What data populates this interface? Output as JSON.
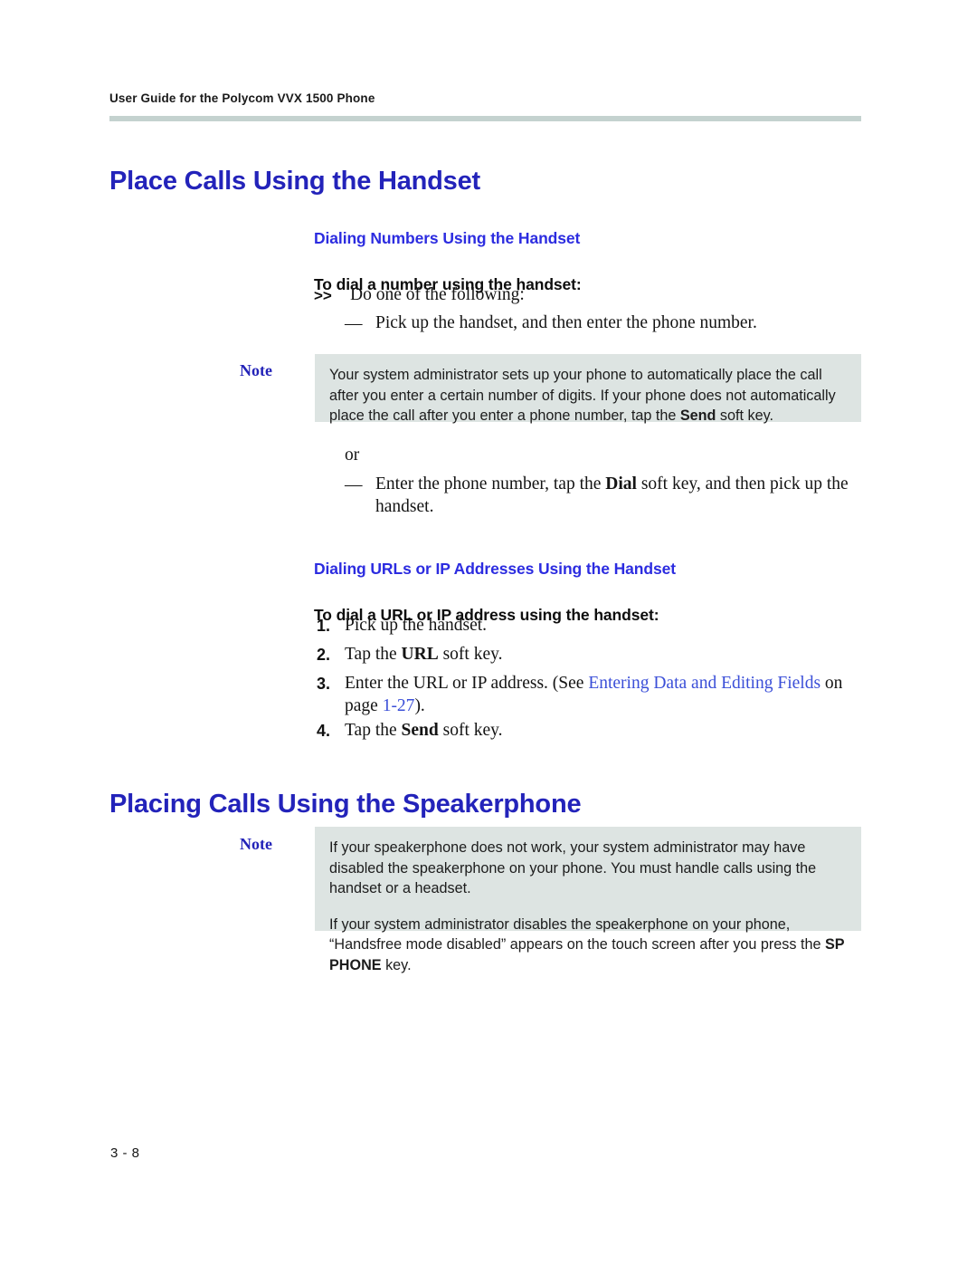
{
  "page": {
    "running_header": "User Guide for the Polycom VVX 1500 Phone",
    "folio": "3 - 8",
    "accent_heading_color": "#2323ba",
    "subheading_color": "#2c2ce0",
    "link_color": "#3b4fd8",
    "note_background": "#dde4e2",
    "rule_color": "#c4d2cf"
  },
  "sections": [
    {
      "heading": "Place Calls Using the Handset",
      "subheading": "Dialing Numbers Using the Handset",
      "procedure_title": "To dial a number using the handset:",
      "lead_marker": ">>",
      "lead_text": "Do one of the following:",
      "dash_marker": "—",
      "option_one": "Pick up the handset, and then enter the phone number.",
      "or_text": "or",
      "option_two_pre": "Enter the phone number, tap the ",
      "option_two_bold": "Dial",
      "option_two_post": " soft key, and then pick up the handset.",
      "note_label": "Note",
      "note_pre": "Your system administrator sets up your phone to automatically place the call after you enter a certain number of digits. If your phone does not automatically place the call after you enter a phone number, tap the ",
      "note_bold": "Send",
      "note_post": " soft key."
    },
    {
      "subheading": "Dialing URLs or IP Addresses Using the Handset",
      "procedure_title": "To dial a URL or IP address using the handset:",
      "steps": [
        {
          "num": "1.",
          "pre": "Pick up the handset.",
          "bold": "",
          "post": ""
        },
        {
          "num": "2.",
          "pre": "Tap the ",
          "bold": "URL",
          "post": " soft key."
        },
        {
          "num": "3.",
          "pre": "Enter the URL or IP address. (See ",
          "link1": "Entering Data and Editing Fields",
          "mid": " on page ",
          "link2": "1-27",
          "post": ")."
        },
        {
          "num": "4.",
          "pre": "Tap the ",
          "bold": "Send",
          "post": " soft key."
        }
      ]
    },
    {
      "heading": "Placing Calls Using the Speakerphone",
      "note_label": "Note",
      "note_p1": "If your speakerphone does not work, your system administrator may have disabled the speakerphone on your phone. You must handle calls using the handset or a headset.",
      "note_p2_pre": "If your system administrator disables the speakerphone on your phone, “Handsfree mode disabled” appears on the touch screen after you press the ",
      "note_p2_bold": "SP PHONE",
      "note_p2_post": " key."
    }
  ]
}
